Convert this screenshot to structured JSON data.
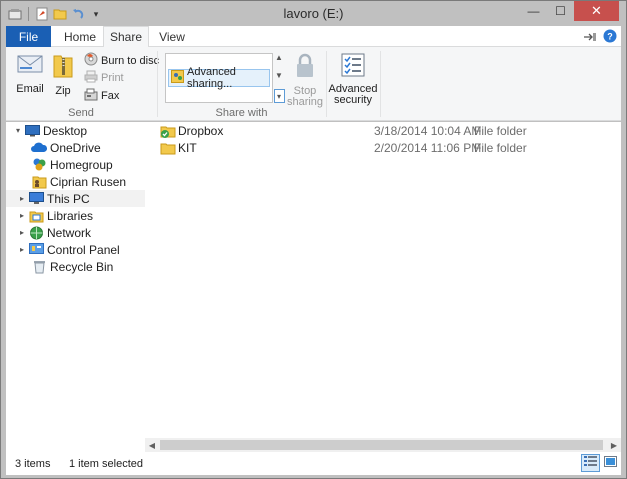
{
  "window": {
    "title": "lavoro (E:)",
    "controls": {
      "minimize": "—",
      "maximize": "☐",
      "close": "✕"
    }
  },
  "quick_access": [
    "properties-icon",
    "new-folder-icon",
    "undo-icon",
    "customize-dropdown"
  ],
  "ribbon_tabs": [
    {
      "label": "File"
    },
    {
      "label": "Home"
    },
    {
      "label": "Share",
      "active": true
    },
    {
      "label": "View"
    }
  ],
  "ribbon": {
    "send": {
      "group_label": "Send",
      "email_label": "Email",
      "zip_label": "Zip",
      "burn_label": "Burn to disc",
      "print_label": "Print",
      "fax_label": "Fax"
    },
    "share_with": {
      "group_label": "Share with",
      "gallery_item": "Advanced sharing...",
      "stop_sharing_label_1": "Stop",
      "stop_sharing_label_2": "sharing"
    },
    "security": {
      "label_1": "Advanced",
      "label_2": "security"
    }
  },
  "nav_pane": [
    {
      "label": "Desktop",
      "icon": "desktop-icon",
      "expand": "▾"
    },
    {
      "label": "OneDrive",
      "icon": "onedrive-icon"
    },
    {
      "label": "Homegroup",
      "icon": "homegroup-icon"
    },
    {
      "label": "Ciprian Rusen",
      "icon": "user-folder-icon"
    },
    {
      "label": "This PC",
      "icon": "this-pc-icon",
      "selected": true
    },
    {
      "label": "Libraries",
      "icon": "libraries-icon"
    },
    {
      "label": "Network",
      "icon": "network-icon"
    },
    {
      "label": "Control Panel",
      "icon": "control-panel-icon"
    },
    {
      "label": "Recycle Bin",
      "icon": "recycle-bin-icon"
    }
  ],
  "files": [
    {
      "name": "Dropbox",
      "date": "3/18/2014 10:04 AM",
      "type": "File folder",
      "icon": "dropbox-folder-icon"
    },
    {
      "name": "KIT",
      "date": "2/20/2014 11:06 PM",
      "type": "File folder",
      "icon": "folder-icon"
    }
  ],
  "status_bar": {
    "item_count": "3 items",
    "selection": "1 item selected"
  },
  "colors": {
    "file_tab": "#1a5fb4",
    "close_button": "#c7504d",
    "selection": "#e5f1fb"
  }
}
